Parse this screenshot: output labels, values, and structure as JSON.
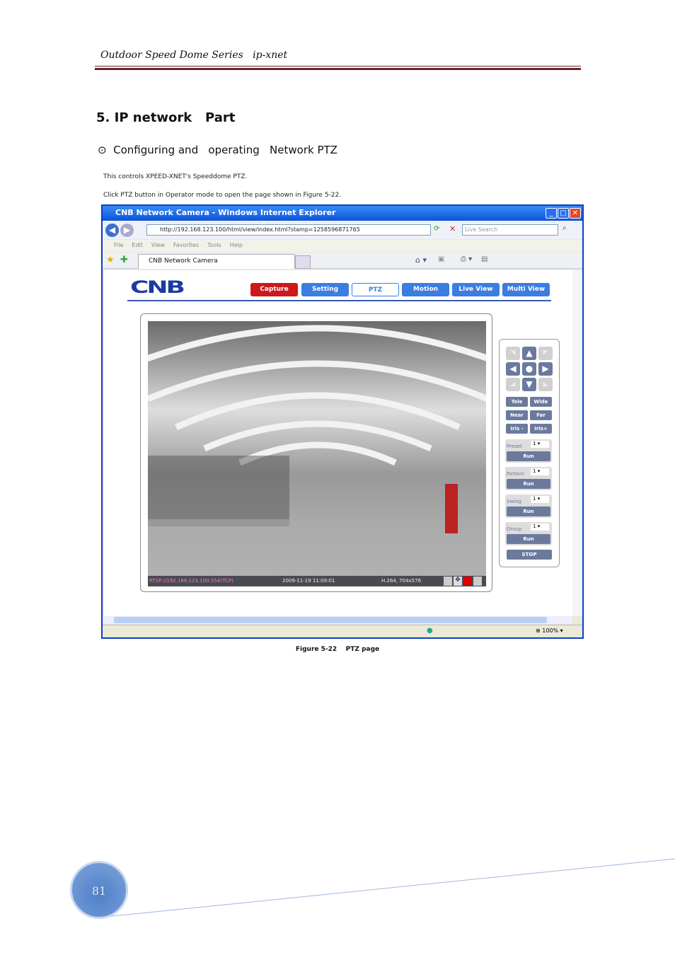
{
  "header": {
    "series": "Outdoor Speed Dome Series   ip-xnet"
  },
  "section": {
    "title": "5. IP network   Part",
    "subtitle": "⊙  Configuring and   operating   Network PTZ"
  },
  "body": {
    "p1": "This controls XPEED-XNET's Speeddome PTZ.",
    "p2": "Click PTZ button in Operator mode to open the page shown in Figure 5-22."
  },
  "browser": {
    "title": "CNB Network Camera - Windows Internet Explorer",
    "url": "http://192.168.123.100/html/view/index.html?stamp=1258596871765",
    "search_placeholder": "Live Search",
    "menu": [
      "File",
      "Edit",
      "View",
      "Favorites",
      "Tools",
      "Help"
    ],
    "tab": "CNB Network Camera",
    "zoom": "100%"
  },
  "app": {
    "logo": "CNB",
    "tabs": [
      "Capture",
      "Setting",
      "PTZ",
      "Motion",
      "Live View",
      "Multi View"
    ],
    "active_tab": "PTZ"
  },
  "video": {
    "stream": "RTSP://192.168.123.100:554(TCP)",
    "timestamp": "2009-11-19 11:09:01",
    "codec": "H.264, 704x576"
  },
  "ptz": {
    "tele": "Tele",
    "wide": "Wide",
    "near": "Near",
    "far": "Far",
    "iris_minus": "Iris -",
    "iris_plus": "Iris+",
    "groups": [
      {
        "label": "Preset",
        "value": "1",
        "run": "Run"
      },
      {
        "label": "Pattern",
        "value": "1",
        "run": "Run"
      },
      {
        "label": "Swing",
        "value": "1",
        "run": "Run"
      },
      {
        "label": "Group",
        "value": "1",
        "run": "Run"
      }
    ],
    "stop": "STOP"
  },
  "caption": "Figure 5-22    PTZ page",
  "page_number": "81"
}
